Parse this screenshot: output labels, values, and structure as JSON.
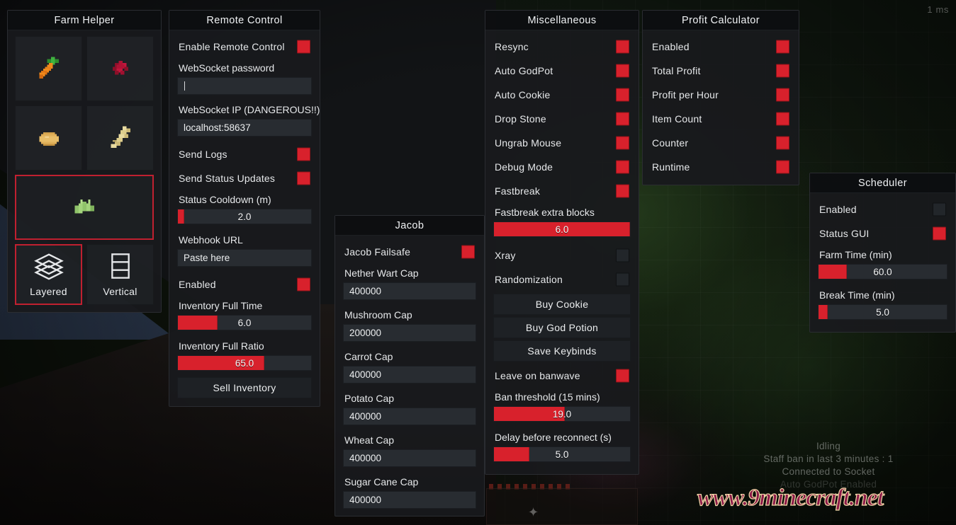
{
  "hud": {
    "ms_counter": "1 ms",
    "status_lines": [
      {
        "text": "Idling",
        "dim": false
      },
      {
        "text": "Staff ban in last 3 minutes : 1",
        "dim": false
      },
      {
        "text": "Connected to Socket",
        "dim": false
      },
      {
        "text": "Auto GodPot Enabled",
        "dim": true
      }
    ],
    "watermark": "www.9minecraft.net"
  },
  "farm_helper": {
    "title": "Farm Helper",
    "crops": [
      {
        "name": "carrot",
        "selected": false
      },
      {
        "name": "nether-wart",
        "selected": false
      },
      {
        "name": "potato",
        "selected": false
      },
      {
        "name": "wheat",
        "selected": false
      },
      {
        "name": "sugar-cane",
        "selected": true
      }
    ],
    "modes": [
      {
        "label": "Layered",
        "icon": "layers-icon",
        "selected": true
      },
      {
        "label": "Vertical",
        "icon": "vertical-stack-icon",
        "selected": false
      }
    ]
  },
  "remote_control": {
    "title": "Remote Control",
    "enable_label": "Enable Remote Control",
    "enable_on": true,
    "password_label": "WebSocket password",
    "password_value": "",
    "ip_label": "WebSocket IP (DANGEROUS!!)",
    "ip_value": "localhost:58637",
    "send_logs_label": "Send Logs",
    "send_logs_on": true,
    "send_status_label": "Send Status Updates",
    "send_status_on": true,
    "status_cooldown_label": "Status Cooldown (m)",
    "status_cooldown_value": "2.0",
    "status_cooldown_pct": 5,
    "webhook_label": "Webhook URL",
    "webhook_value": "Paste here",
    "enabled_label": "Enabled",
    "enabled_on": true,
    "inv_full_time_label": "Inventory Full Time",
    "inv_full_time_value": "6.0",
    "inv_full_time_pct": 30,
    "inv_full_ratio_label": "Inventory Full Ratio",
    "inv_full_ratio_value": "65.0",
    "inv_full_ratio_pct": 65,
    "sell_inventory_label": "Sell Inventory"
  },
  "jacob": {
    "title": "Jacob",
    "failsafe_label": "Jacob Failsafe",
    "failsafe_on": true,
    "caps": [
      {
        "label": "Nether Wart Cap",
        "value": "400000"
      },
      {
        "label": "Mushroom Cap",
        "value": "200000"
      },
      {
        "label": "Carrot Cap",
        "value": "400000"
      },
      {
        "label": "Potato Cap",
        "value": "400000"
      },
      {
        "label": "Wheat Cap",
        "value": "400000"
      },
      {
        "label": "Sugar Cane Cap",
        "value": "400000"
      }
    ]
  },
  "miscellaneous": {
    "title": "Miscellaneous",
    "toggles": [
      {
        "label": "Resync",
        "on": true
      },
      {
        "label": "Auto GodPot",
        "on": true
      },
      {
        "label": "Auto Cookie",
        "on": true
      },
      {
        "label": "Drop Stone",
        "on": true
      },
      {
        "label": "Ungrab Mouse",
        "on": true
      },
      {
        "label": "Debug Mode",
        "on": true
      },
      {
        "label": "Fastbreak",
        "on": true
      }
    ],
    "fastbreak_blocks_label": "Fastbreak extra blocks",
    "fastbreak_blocks_value": "6.0",
    "fastbreak_blocks_pct": 100,
    "xray_label": "Xray",
    "xray_on": false,
    "randomization_label": "Randomization",
    "randomization_on": false,
    "buttons": [
      {
        "label": "Buy Cookie"
      },
      {
        "label": "Buy God Potion"
      },
      {
        "label": "Save Keybinds"
      }
    ],
    "leave_banwave_label": "Leave on banwave",
    "leave_banwave_on": true,
    "ban_threshold_label": "Ban threshold (15 mins)",
    "ban_threshold_value": "19.0",
    "ban_threshold_pct": 52,
    "reconnect_delay_label": "Delay before reconnect (s)",
    "reconnect_delay_value": "5.0",
    "reconnect_delay_pct": 26
  },
  "profit_calculator": {
    "title": "Profit Calculator",
    "toggles": [
      {
        "label": "Enabled",
        "on": true
      },
      {
        "label": "Total Profit",
        "on": true
      },
      {
        "label": "Profit per Hour",
        "on": true
      },
      {
        "label": "Item Count",
        "on": true
      },
      {
        "label": "Counter",
        "on": true
      },
      {
        "label": "Runtime",
        "on": true
      }
    ]
  },
  "scheduler": {
    "title": "Scheduler",
    "enabled_label": "Enabled",
    "enabled_on": false,
    "status_gui_label": "Status GUI",
    "status_gui_on": true,
    "farm_time_label": "Farm Time (min)",
    "farm_time_value": "60.0",
    "farm_time_pct": 22,
    "break_time_label": "Break Time (min)",
    "break_time_value": "5.0",
    "break_time_pct": 7
  },
  "colors": {
    "accent_red": "#d8212c",
    "selection_border": "#c02030",
    "panel_bg": "#181a1d",
    "title_bg": "#0d0e10",
    "text": "#e8eaec"
  }
}
